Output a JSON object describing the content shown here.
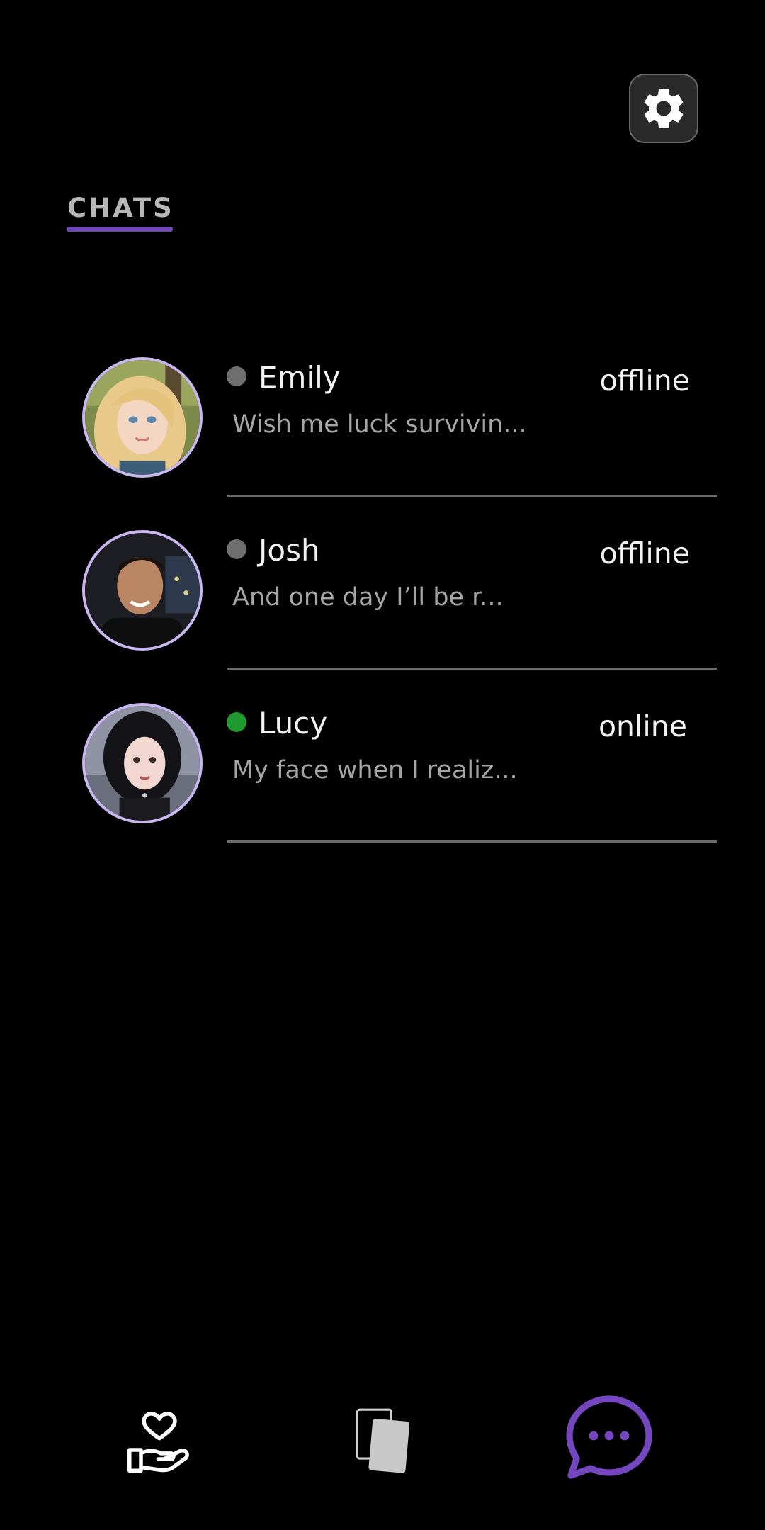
{
  "header": {
    "title": "CHATS"
  },
  "chats": [
    {
      "name": "Emily",
      "status": "offline",
      "preview": "Wish me luck survivin...",
      "status_color": "#6e6e6e"
    },
    {
      "name": "Josh",
      "status": "offline",
      "preview": "And one day I’ll be r...",
      "status_color": "#6e6e6e"
    },
    {
      "name": "Lucy",
      "status": "online",
      "preview": "My face when I realiz...",
      "status_color": "#1e9a2e"
    }
  ],
  "icons": {
    "settings": "gear-icon",
    "nav_like": "heart-hand-icon",
    "nav_cards": "cards-icon",
    "nav_chats": "chat-bubble-icon"
  },
  "colors": {
    "accent": "#7446c0",
    "background": "#000000",
    "avatar_ring": "#c9b6ef"
  }
}
